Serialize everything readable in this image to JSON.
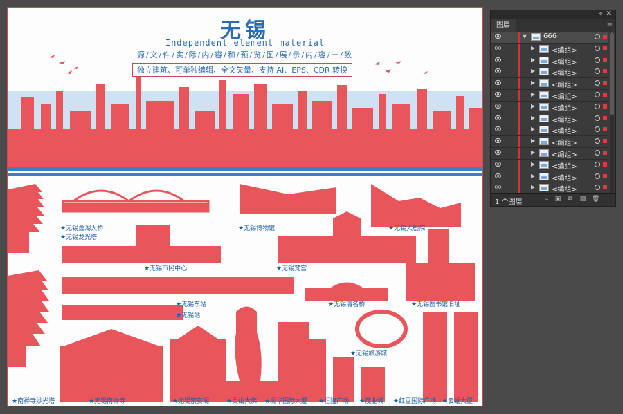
{
  "artboard": {
    "title": "无锡",
    "subtitle_en": "Independent element material",
    "subtitle_cn": "源/文/件/实/际/内/容/和/预/览/图/展/示/内/容/一/致",
    "features": "独立建筑、可单独编辑、全文矢量、支持 AI、EPS、CDR 转换"
  },
  "landmarks": [
    "无锡蠡湖大桥",
    "无锡龙光塔",
    "无锡博物馆",
    "无锡大剧院",
    "无锡市民中心",
    "无锡梵宫",
    "无锡东站",
    "无锡站",
    "无锡清名桥",
    "无锡图书馆旧址",
    "无锡旅游城",
    "南禅寺妙光塔",
    "无锡南禅寺",
    "无锡崇安阁",
    "灵山大佛",
    "润华国际大厦",
    "恒隆广场",
    "茂业城",
    "红豆国际广场",
    "云蝠大厦"
  ],
  "layers_panel": {
    "tab": "图层",
    "top_layer": "666",
    "group_label": "<编组>",
    "group_count": 14,
    "footer_count": "1 个图层"
  },
  "colors": {
    "building_red": "#e8565b",
    "accent_blue": "#2c6cb1",
    "sky_blue": "#a9cdea"
  }
}
